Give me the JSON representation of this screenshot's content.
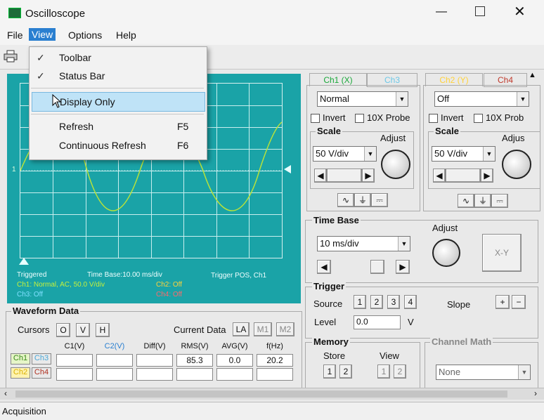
{
  "window": {
    "title": "Oscilloscope"
  },
  "menu": {
    "file": "File",
    "view": "View",
    "options": "Options",
    "help": "Help"
  },
  "view_menu": {
    "toolbar": "Toolbar",
    "status_bar": "Status Bar",
    "display_only": "Display Only",
    "refresh": "Refresh",
    "refresh_key": "F5",
    "continuous_refresh": "Continuous Refresh",
    "continuous_refresh_key": "F6"
  },
  "screen": {
    "triggered": "Triggered",
    "time_base": "Time Base:10.00 ms/div",
    "trigger_pos": "Trigger POS, Ch1",
    "ch1_info": "Ch1: Normal, AC, 50.0 V/div",
    "ch2_info": "Ch2: Off",
    "ch3_info": "Ch3: Off",
    "ch4_info": "Ch4: Off",
    "marker": "1"
  },
  "tabs": {
    "ch1": "Ch1 (X)",
    "ch3": "Ch3",
    "ch2": "Ch2 (Y)",
    "ch4": "Ch4"
  },
  "left_channel": {
    "mode": "Normal",
    "invert": "Invert",
    "probe": "10X Probe",
    "scale_title": "Scale",
    "adjust": "Adjust",
    "scale_value": "50 V/div"
  },
  "right_channel": {
    "mode": "Off",
    "invert": "Invert",
    "probe": "10X Prob",
    "scale_title": "Scale",
    "adjust": "Adjus",
    "scale_value": "50 V/div"
  },
  "time_base": {
    "title": "Time Base",
    "adjust": "Adjust",
    "value": "10 ms/div",
    "xy": "X-Y"
  },
  "trigger": {
    "title": "Trigger",
    "source": "Source",
    "sources": [
      "1",
      "2",
      "3",
      "4"
    ],
    "slope": "Slope",
    "slope_plus": "+",
    "slope_minus": "−",
    "level": "Level",
    "level_value": "0.0",
    "level_unit": "V"
  },
  "waveform": {
    "title": "Waveform Data",
    "cursors": "Cursors",
    "cursor_buttons": [
      "O",
      "V",
      "H"
    ],
    "current_data": "Current Data",
    "data_buttons": [
      "LA",
      "M1",
      "M2"
    ],
    "headers": [
      "C1(V)",
      "C2(V)",
      "Diff(V)",
      "RMS(V)",
      "AVG(V)",
      "f(Hz)"
    ],
    "row_tags": [
      "Ch1",
      "Ch3",
      "Ch2",
      "Ch4"
    ],
    "ch1_values": [
      "",
      "",
      "",
      "85.3",
      "0.0",
      "20.2"
    ]
  },
  "memory": {
    "title": "Memory",
    "store": "Store",
    "view": "View",
    "buttons": [
      "1",
      "2"
    ]
  },
  "channel_math": {
    "title": "Channel Math",
    "value": "None"
  },
  "status": {
    "text": "Acquisition"
  },
  "colors": {
    "screen": "#1aa3a7",
    "trace": "#b8e23a",
    "menu_highlight": "#2a7fd0",
    "hover": "#bfe3f7"
  },
  "icons": [
    "app-icon",
    "minimize-icon",
    "maximize-icon",
    "close-icon",
    "print-icon",
    "check-icon",
    "cursor-icon",
    "knob-icon"
  ]
}
